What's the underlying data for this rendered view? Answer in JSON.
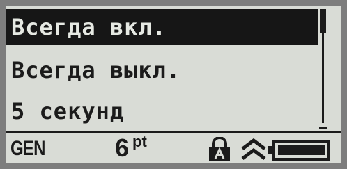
{
  "menu": {
    "items": [
      {
        "label": "Всегда вкл.",
        "selected": true
      },
      {
        "label": "Всегда выкл.",
        "selected": false
      },
      {
        "label": "5 секунд",
        "selected": false
      }
    ]
  },
  "status_bar": {
    "mode": "GEN",
    "font_size_value": "6",
    "font_size_unit": "pt",
    "icons": [
      "caps-lock-icon",
      "shift-icon",
      "battery-icon"
    ],
    "battery_level": 1.0
  },
  "colors": {
    "lcd_background": "#d9dcd6",
    "pixel": "#1b1b1b",
    "bezel": "#7d7d7d"
  }
}
